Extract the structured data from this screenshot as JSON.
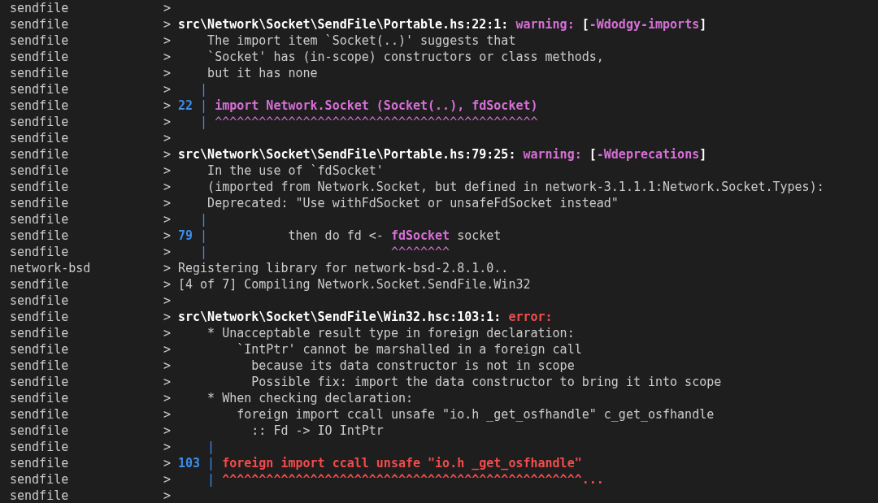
{
  "terminal": {
    "lines": [
      {
        "source": "sendfile",
        "prompt": ">"
      },
      {
        "source": "sendfile",
        "prompt": ">",
        "segments": [
          {
            "kind": "path",
            "text": "src\\Network\\Socket\\SendFile\\Portable.hs:22:1:"
          },
          {
            "kind": "warning",
            "text": " warning:"
          },
          {
            "kind": "bracket",
            "text": " ["
          },
          {
            "kind": "warning",
            "text": "-Wdodgy-imports"
          },
          {
            "kind": "bracket",
            "text": "]"
          }
        ]
      },
      {
        "source": "sendfile",
        "prompt": ">",
        "segments": [
          {
            "kind": "plain",
            "text": "    The import item `Socket(..)' suggests that"
          }
        ]
      },
      {
        "source": "sendfile",
        "prompt": ">",
        "segments": [
          {
            "kind": "plain",
            "text": "    `Socket' has (in-scope) constructors or class methods,"
          }
        ]
      },
      {
        "source": "sendfile",
        "prompt": ">",
        "segments": [
          {
            "kind": "plain",
            "text": "    but it has none"
          }
        ]
      },
      {
        "source": "sendfile",
        "prompt": ">",
        "segments": [
          {
            "kind": "gutter",
            "text": "   |"
          }
        ]
      },
      {
        "source": "sendfile",
        "prompt": ">",
        "segments": [
          {
            "kind": "lineno",
            "text": "22"
          },
          {
            "kind": "gutter",
            "text": " |"
          },
          {
            "kind": "code",
            "text": " import Network.Socket (Socket(..), fdSocket)"
          }
        ]
      },
      {
        "source": "sendfile",
        "prompt": ">",
        "segments": [
          {
            "kind": "gutter",
            "text": "   |"
          },
          {
            "kind": "caret",
            "text": " ^^^^^^^^^^^^^^^^^^^^^^^^^^^^^^^^^^^^^^^^^^^^"
          }
        ]
      },
      {
        "source": "sendfile",
        "prompt": ">"
      },
      {
        "source": "sendfile",
        "prompt": ">",
        "segments": [
          {
            "kind": "path",
            "text": "src\\Network\\Socket\\SendFile\\Portable.hs:79:25:"
          },
          {
            "kind": "warning",
            "text": " warning:"
          },
          {
            "kind": "bracket",
            "text": " ["
          },
          {
            "kind": "warning",
            "text": "-Wdeprecations"
          },
          {
            "kind": "bracket",
            "text": "]"
          }
        ]
      },
      {
        "source": "sendfile",
        "prompt": ">",
        "segments": [
          {
            "kind": "plain",
            "text": "    In the use of `fdSocket'"
          }
        ]
      },
      {
        "source": "sendfile",
        "prompt": ">",
        "segments": [
          {
            "kind": "plain",
            "text": "    (imported from Network.Socket, but defined in network-3.1.1.1:Network.Socket.Types):"
          }
        ]
      },
      {
        "source": "sendfile",
        "prompt": ">",
        "segments": [
          {
            "kind": "plain",
            "text": "    Deprecated: \"Use withFdSocket or unsafeFdSocket instead\""
          }
        ]
      },
      {
        "source": "sendfile",
        "prompt": ">",
        "segments": [
          {
            "kind": "gutter",
            "text": "   |"
          }
        ]
      },
      {
        "source": "sendfile",
        "prompt": ">",
        "segments": [
          {
            "kind": "lineno",
            "text": "79"
          },
          {
            "kind": "gutter",
            "text": " |"
          },
          {
            "kind": "plain",
            "text": "           then do fd <- "
          },
          {
            "kind": "code",
            "text": "fdSocket"
          },
          {
            "kind": "plain",
            "text": " socket"
          }
        ]
      },
      {
        "source": "sendfile",
        "prompt": ">",
        "segments": [
          {
            "kind": "gutter",
            "text": "   |"
          },
          {
            "kind": "caret",
            "text": "                         ^^^^^^^^"
          }
        ]
      },
      {
        "source": "network-bsd",
        "prompt": ">",
        "segments": [
          {
            "kind": "plain",
            "text": "Registering library for network-bsd-2.8.1.0.."
          }
        ]
      },
      {
        "source": "sendfile",
        "prompt": ">",
        "segments": [
          {
            "kind": "plain",
            "text": "[4 of 7] Compiling Network.Socket.SendFile.Win32"
          }
        ]
      },
      {
        "source": "sendfile",
        "prompt": ">"
      },
      {
        "source": "sendfile",
        "prompt": ">",
        "segments": [
          {
            "kind": "path",
            "text": "src\\Network\\Socket\\SendFile\\Win32.hsc:103:1:"
          },
          {
            "kind": "error",
            "text": " error:"
          }
        ]
      },
      {
        "source": "sendfile",
        "prompt": ">",
        "segments": [
          {
            "kind": "plain",
            "text": "    * Unacceptable result type in foreign declaration:"
          }
        ]
      },
      {
        "source": "sendfile",
        "prompt": ">",
        "segments": [
          {
            "kind": "plain",
            "text": "        `IntPtr' cannot be marshalled in a foreign call"
          }
        ]
      },
      {
        "source": "sendfile",
        "prompt": ">",
        "segments": [
          {
            "kind": "plain",
            "text": "          because its data constructor is not in scope"
          }
        ]
      },
      {
        "source": "sendfile",
        "prompt": ">",
        "segments": [
          {
            "kind": "plain",
            "text": "          Possible fix: import the data constructor to bring it into scope"
          }
        ]
      },
      {
        "source": "sendfile",
        "prompt": ">",
        "segments": [
          {
            "kind": "plain",
            "text": "    * When checking declaration:"
          }
        ]
      },
      {
        "source": "sendfile",
        "prompt": ">",
        "segments": [
          {
            "kind": "plain",
            "text": "        foreign import ccall unsafe \"io.h _get_osfhandle\" c_get_osfhandle"
          }
        ]
      },
      {
        "source": "sendfile",
        "prompt": ">",
        "segments": [
          {
            "kind": "plain",
            "text": "          :: Fd -> IO IntPtr"
          }
        ]
      },
      {
        "source": "sendfile",
        "prompt": ">",
        "segments": [
          {
            "kind": "gutter",
            "text": "    |"
          }
        ]
      },
      {
        "source": "sendfile",
        "prompt": ">",
        "segments": [
          {
            "kind": "lineno",
            "text": "103"
          },
          {
            "kind": "gutter",
            "text": " |"
          },
          {
            "kind": "errcode",
            "text": " foreign import ccall unsafe \"io.h _get_osfhandle\""
          }
        ]
      },
      {
        "source": "sendfile",
        "prompt": ">",
        "segments": [
          {
            "kind": "gutter",
            "text": "    |"
          },
          {
            "kind": "errcode",
            "text": " ^^^^^^^^^^^^^^^^^^^^^^^^^^^^^^^^^^^^^^^^^^^^^^^^^..."
          }
        ]
      },
      {
        "source": "sendfile",
        "prompt": ">"
      }
    ]
  }
}
